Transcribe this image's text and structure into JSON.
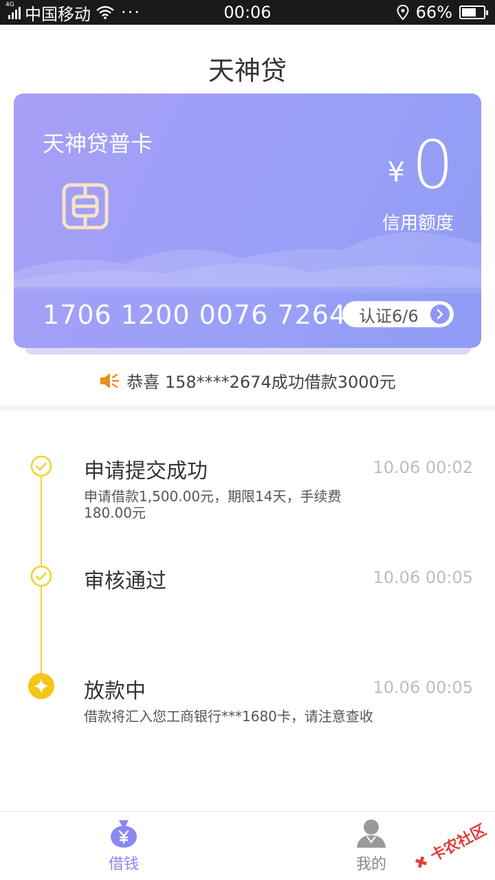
{
  "status_bar": {
    "network": "4G",
    "carrier": "中国移动",
    "dots": "···",
    "time": "00:06",
    "battery": "66%",
    "battery_level": 0.66
  },
  "page": {
    "title": "天神贷"
  },
  "card": {
    "name": "天神贷普卡",
    "currency": "¥",
    "amount": "0",
    "credit_label": "信用额度",
    "number": "1706 1200 0076 7264",
    "verify_label": "认证6/6"
  },
  "notice": {
    "text": "恭喜 158****2674成功借款3000元"
  },
  "timeline": [
    {
      "title": "申请提交成功",
      "time": "10.06 00:02",
      "desc": "申请借款1,500.00元，期限14天，手续费180.00元",
      "status": "done"
    },
    {
      "title": "审核通过",
      "time": "10.06 00:05",
      "desc": "",
      "status": "done"
    },
    {
      "title": "放款中",
      "time": "10.06 00:05",
      "desc": "借款将汇入您工商银行***1680卡，请注意查收",
      "status": "active"
    }
  ],
  "nav": {
    "borrow": {
      "label": "借钱",
      "color": "#8a88f0"
    },
    "mine": {
      "label": "我的",
      "color": "#888888"
    }
  },
  "watermark": "卡农社区",
  "colors": {
    "accent": "#f3d22e",
    "active_dot": "#f5c518",
    "card": "#9aa0f7",
    "speaker": "#f08a1c"
  }
}
